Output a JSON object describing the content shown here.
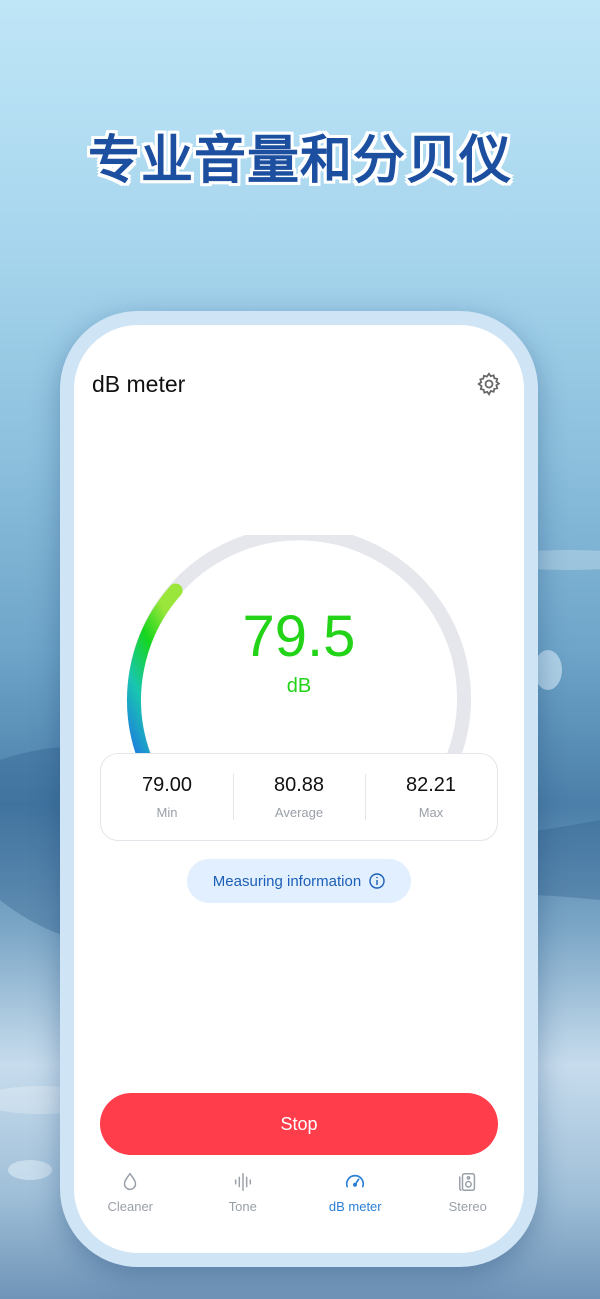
{
  "headline": "专业音量和分贝仪",
  "app": {
    "title": "dB meter",
    "settings_icon": "gear-icon"
  },
  "reading": {
    "value": "79.5",
    "unit": "dB",
    "gauge_level_fraction": 0.28,
    "accent_color": "#22d317"
  },
  "stats": [
    {
      "value": "79.00",
      "label": "Min"
    },
    {
      "value": "80.88",
      "label": "Average"
    },
    {
      "value": "82.21",
      "label": "Max"
    }
  ],
  "info_button": {
    "label": "Measuring information",
    "icon": "info-icon"
  },
  "stop_button": {
    "label": "Stop",
    "color": "#ff3d4b"
  },
  "tabs": [
    {
      "label": "Cleaner",
      "icon": "droplet-icon",
      "active": false
    },
    {
      "label": "Tone",
      "icon": "waveform-icon",
      "active": false
    },
    {
      "label": "dB meter",
      "icon": "gauge-icon",
      "active": true
    },
    {
      "label": "Stereo",
      "icon": "speaker-icon",
      "active": false
    }
  ]
}
